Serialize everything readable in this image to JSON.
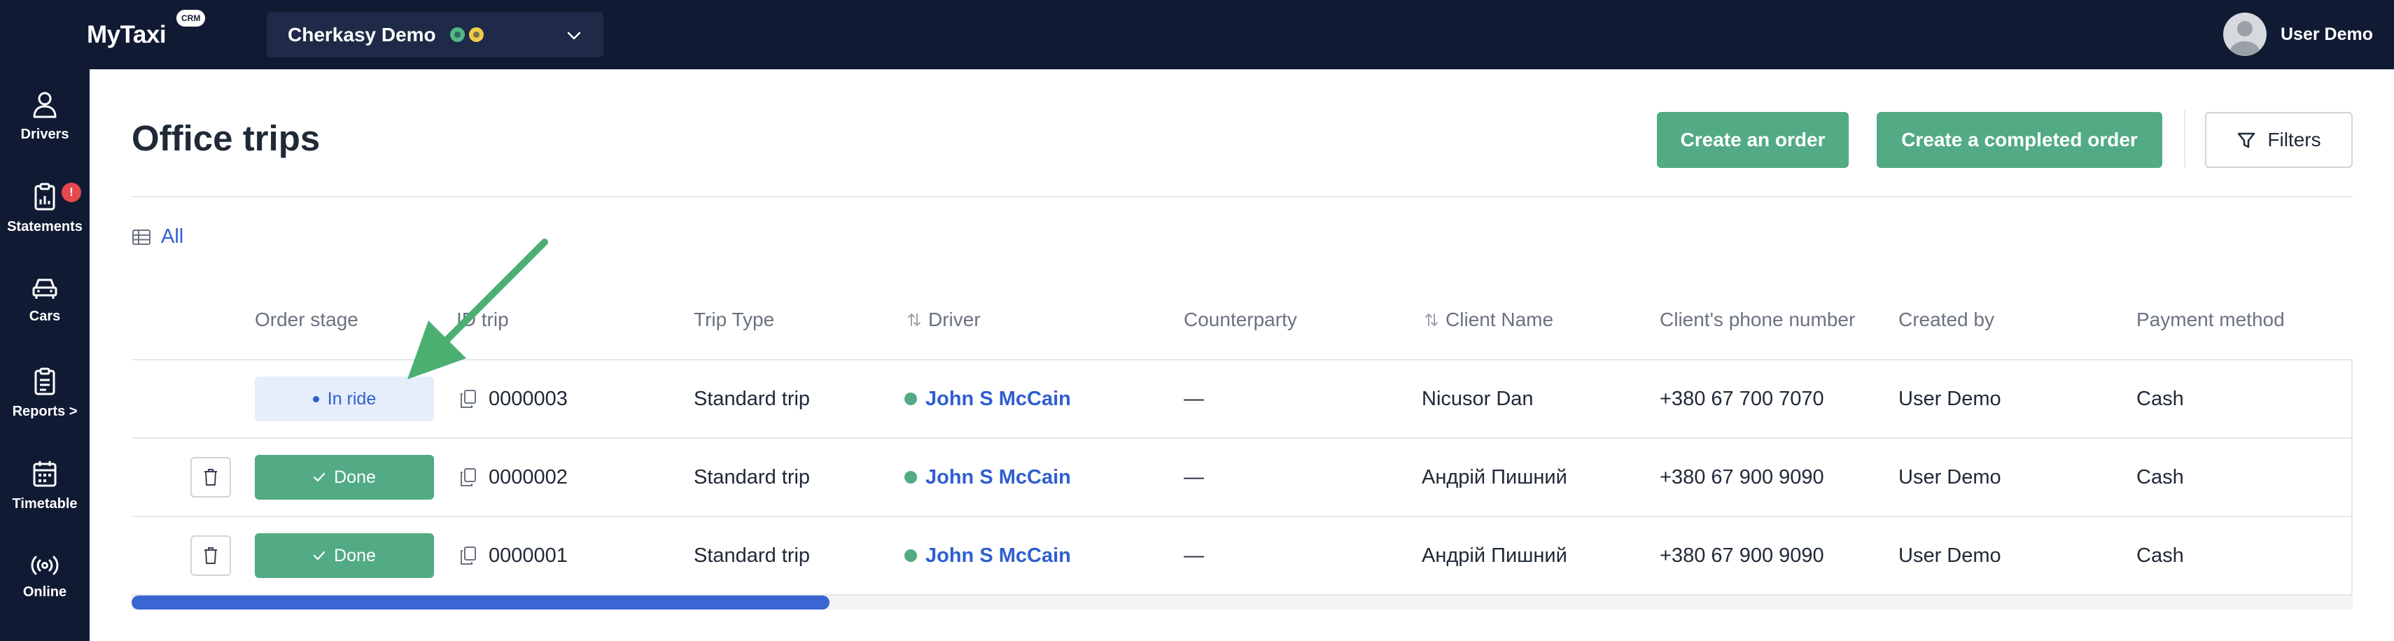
{
  "app": {
    "logo_text": "MyTaxi",
    "logo_badge": "CRM",
    "company": "Cherkasy Demo",
    "user_name": "User Demo"
  },
  "sidebar": {
    "items": [
      {
        "label": "Drivers",
        "icon": "user-icon"
      },
      {
        "label": "Statements",
        "icon": "clipboard-chart-icon",
        "badge": "!"
      },
      {
        "label": "Cars",
        "icon": "car-icon"
      },
      {
        "label": "Reports >",
        "icon": "clipboard-list-icon"
      },
      {
        "label": "Timetable",
        "icon": "calendar-icon"
      },
      {
        "label": "Online",
        "icon": "broadcast-icon"
      }
    ]
  },
  "page": {
    "title": "Office trips",
    "create_order": "Create an order",
    "create_completed": "Create a completed order",
    "filters": "Filters",
    "view_all": "All"
  },
  "table": {
    "columns": [
      "Order stage",
      "ID trip",
      "Trip Type",
      "Driver",
      "Counterparty",
      "Client Name",
      "Client's phone number",
      "Created by",
      "Payment method"
    ],
    "rows": [
      {
        "stage": "In ride",
        "id": "0000003",
        "type": "Standard trip",
        "driver": "John S McCain",
        "counterparty": "—",
        "client": "Nicusor Dan",
        "phone": "+380 67 700 7070",
        "created_by": "User Demo",
        "payment": "Cash"
      },
      {
        "stage": "Done",
        "id": "0000002",
        "type": "Standard trip",
        "driver": "John S McCain",
        "counterparty": "—",
        "client": "Андрій Пишний",
        "phone": "+380 67 900 9090",
        "created_by": "User Demo",
        "payment": "Cash"
      },
      {
        "stage": "Done",
        "id": "0000001",
        "type": "Standard trip",
        "driver": "John S McCain",
        "counterparty": "—",
        "client": "Андрій Пишний",
        "phone": "+380 67 900 9090",
        "created_by": "User Demo",
        "payment": "Cash"
      }
    ]
  },
  "colors": {
    "header_bg": "#101a33",
    "accent_green": "#52ab85",
    "link_blue": "#2f5fcf",
    "badge_red": "#e5484d"
  }
}
